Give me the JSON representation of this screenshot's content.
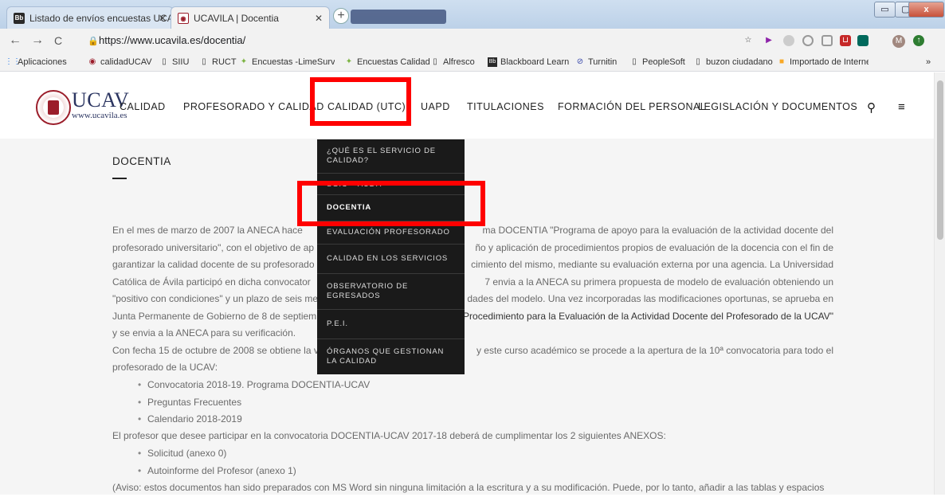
{
  "browser": {
    "tabs": [
      {
        "label": "Listado de envíos encuestas UCA",
        "favicon": "Bb"
      },
      {
        "label": "UCAVILA | Docentia"
      }
    ],
    "new_tab": "+",
    "window_controls": {
      "minimize": "▭",
      "maximize": "▢",
      "close": "x"
    },
    "back": "←",
    "forward": "→",
    "reload": "C",
    "url": "https://www.ucavila.es/docentia/",
    "bookmarks": [
      "Aplicaciones",
      "calidadUCAV",
      "SIIU",
      "RUCT",
      "Encuestas -LimeSurve",
      "Encuestas Calidad",
      "Alfresco",
      "Blackboard Learn",
      "Turnitin",
      "PeopleSoft",
      "buzon ciudadano",
      "Importado de Interne"
    ],
    "bookmarks_more": "»",
    "profile_initial": "M"
  },
  "site": {
    "logo_title": "UCAV",
    "logo_url": "www.ucavila.es",
    "nav": {
      "calidad": "CALIDAD",
      "profesorado": "PROFESORADO Y CALIDAD",
      "calidad_utc": "CALIDAD (UTC)",
      "uapd": "UAPD",
      "titulaciones": "TITULACIONES",
      "formacion": "FORMACIÓN DEL PERSONAL",
      "legislacion": "LEGISLACIÓN Y DOCUMENTOS"
    },
    "dropdown": [
      "¿QUÉ ES EL SERVICIO DE CALIDAD?",
      "SGIC – AUDIT",
      "DOCENTIA",
      "EVALUACIÓN PROFESORADO",
      "CALIDAD EN LOS SERVICIOS",
      "OBSERVATORIO DE EGRESADOS",
      "P.E.I.",
      "ÓRGANOS QUE GESTIONAN LA CALIDAD"
    ]
  },
  "article": {
    "title": "DOCENTIA",
    "p1_line1_left": "En el mes de marzo de 2007 la ANECA hace",
    "p1_line1_right": "ma DOCENTIA \"Programa de apoyo para la evaluación de la actividad docente del",
    "p1_line2_left": "profesorado universitario\", con el objetivo de ap",
    "p1_line2_right": "ño y aplicación de procedimientos propios de evaluación de la docencia con el fin de",
    "p1_line3_left": "garantizar la calidad docente de su profesorado",
    "p1_line3_right": "cimiento del mismo, mediante su evaluación externa por una agencia. La Universidad",
    "p1_line4_left": "Católica de Ávila participó en dicha convocator",
    "p1_line4_right": "7 envia a la ANECA su primera propuesta de modelo de evaluación obteniendo un",
    "p1_line5_left": "\"positivo con condiciones\" y un plazo de seis me",
    "p1_line5_right": "dades del modelo. Una vez incorporadas las modificaciones oportunas, se aprueba en",
    "p1_line6_left": "Junta Permanente de Gobierno de 8 de septiem",
    "p1_line6_link": "Procedimiento para la Evaluación de la Actividad Docente del Profesorado de la UCAV\"",
    "p1_line7": "y se envia a la ANECA para su verificación.",
    "p2_line1_left": "Con fecha 15 de octubre de 2008 se obtiene la v",
    "p2_line1_right": "y este curso académico se procede a la apertura de la 10ª convocatoria para todo el",
    "p2_line2": "profesorado de la UCAV:",
    "list1": [
      "Convocatoria 2018-19. Programa DOCENTIA-UCAV",
      "Preguntas Frecuentes",
      "Calendario 2018-2019"
    ],
    "p3": "El profesor que desee participar en la convocatoria DOCENTIA-UCAV 2017-18 deberá de cumplimentar los 2 siguientes ANEXOS:",
    "list2": [
      "Solicitud (anexo 0)",
      "Autoinforme del Profesor (anexo 1)"
    ],
    "p4": "(Aviso: estos documentos han sido preparados con MS Word sin ninguna limitación a la escritura y a su modificación. Puede, por lo tanto, añadir a las tablas y espacios"
  },
  "colors": {
    "highlight": "#ff0000",
    "dropdown_bg": "#1a1a1a",
    "brand": "#2b3561"
  }
}
